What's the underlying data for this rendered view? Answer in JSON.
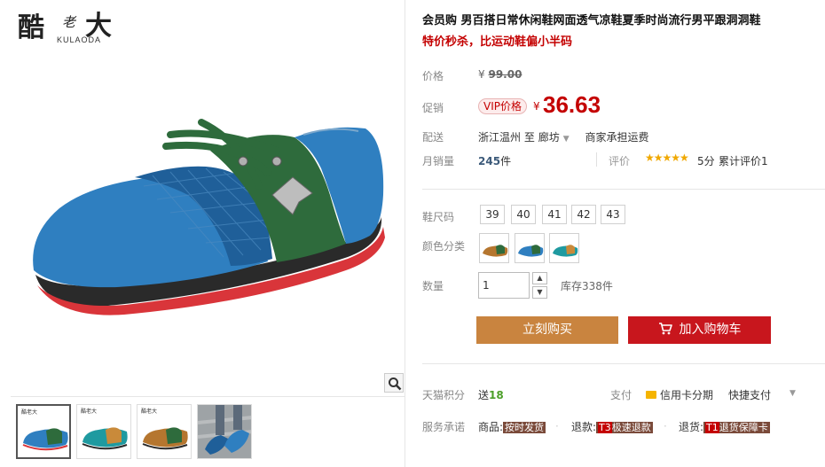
{
  "brand": {
    "logo_char_1": "酷",
    "logo_char_2": "老",
    "logo_char_3": "大",
    "logo_en": "KULAODA"
  },
  "gallery": {
    "zoom_icon": "magnifier-icon",
    "thumbnails": [
      "blue-shoe",
      "teal-shoe",
      "brown-shoe",
      "worn-shoe"
    ]
  },
  "product": {
    "title": "会员购 男百搭日常休闲鞋网面透气凉鞋夏季时尚流行男平跟洞洞鞋",
    "subtitle": "特价秒杀，比运动鞋偏小半码"
  },
  "price": {
    "label": "价格",
    "currency": "¥",
    "original": "99.00"
  },
  "promo": {
    "label": "促销",
    "tag": "VIP价格",
    "currency": "¥",
    "price": "36.63"
  },
  "shipping": {
    "label": "配送",
    "from": "浙江温州",
    "to_word": "至",
    "dest": "廊坊",
    "dropdown_icon": "caret-down-icon",
    "fee": "商家承担运费"
  },
  "sales": {
    "label": "月销量",
    "count": "245",
    "unit": "件",
    "rating_label": "评价",
    "stars": "★★★★★",
    "score": "5分",
    "review_text": "累计评价1"
  },
  "size": {
    "label": "鞋尺码",
    "options": [
      "39",
      "40",
      "41",
      "42",
      "43"
    ]
  },
  "color": {
    "label": "颜色分类",
    "options": [
      "blue",
      "teal",
      "brown"
    ]
  },
  "quantity": {
    "label": "数量",
    "value": "1",
    "stock": "库存338件"
  },
  "actions": {
    "buy_now": "立刻购买",
    "add_to_cart": "加入购物车",
    "cart_icon": "cart-icon"
  },
  "points": {
    "label": "天猫积分",
    "prefix": "送",
    "value": "18",
    "pay_label": "支付",
    "credit_card": "信用卡分期",
    "quick_pay": "快捷支付"
  },
  "service": {
    "label": "服务承诺",
    "item1_prefix": "商品:",
    "item1_badge": "按时发货",
    "item2_prefix": "退款:",
    "item2_tag": "T3",
    "item2_badge": "极速退款",
    "item3_prefix": "退货:",
    "item3_tag": "T1",
    "item3_badge": "退货保障卡"
  },
  "colors": {
    "accent_red": "#c40000",
    "buy_orange": "#c9843f",
    "cart_red": "#c8161d",
    "points_green": "#4c9f29"
  }
}
